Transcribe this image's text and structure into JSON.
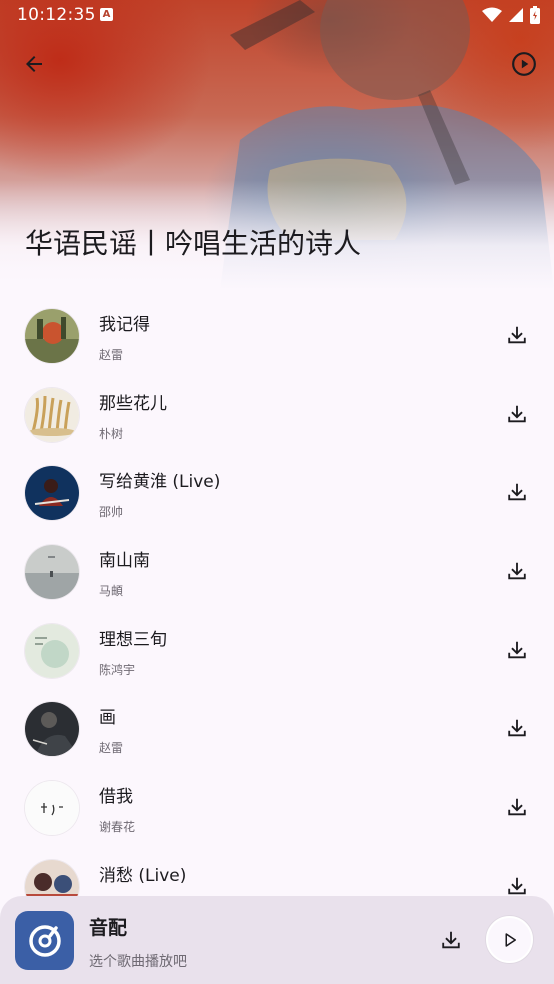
{
  "status_bar": {
    "time": "10:12:35",
    "notification_icon": "a-badge-icon",
    "icons": [
      "wifi-icon",
      "signal-icon",
      "battery-icon"
    ]
  },
  "toolbar": {
    "back_icon": "arrow-left-icon",
    "play_icon": "play-circle-icon"
  },
  "playlist": {
    "title": "华语民谣丨吟唱生活的诗人"
  },
  "songs": [
    {
      "title": "我记得",
      "artist": "赵雷"
    },
    {
      "title": "那些花儿",
      "artist": "朴树"
    },
    {
      "title": "写给黄淮 (Live)",
      "artist": "邵帅"
    },
    {
      "title": "南山南",
      "artist": "马頔"
    },
    {
      "title": "理想三旬",
      "artist": "陈鸿宇"
    },
    {
      "title": "画",
      "artist": "赵雷"
    },
    {
      "title": "借我",
      "artist": "谢春花"
    },
    {
      "title": "消愁 (Live)",
      "artist": ""
    }
  ],
  "player": {
    "title": "音配",
    "subtitle": "选个歌曲播放吧"
  },
  "colors": {
    "background": "#fcf7fd",
    "player_bg": "#e9e1ec",
    "app_icon": "#3b5fa6",
    "header_red": "#c0442b"
  }
}
